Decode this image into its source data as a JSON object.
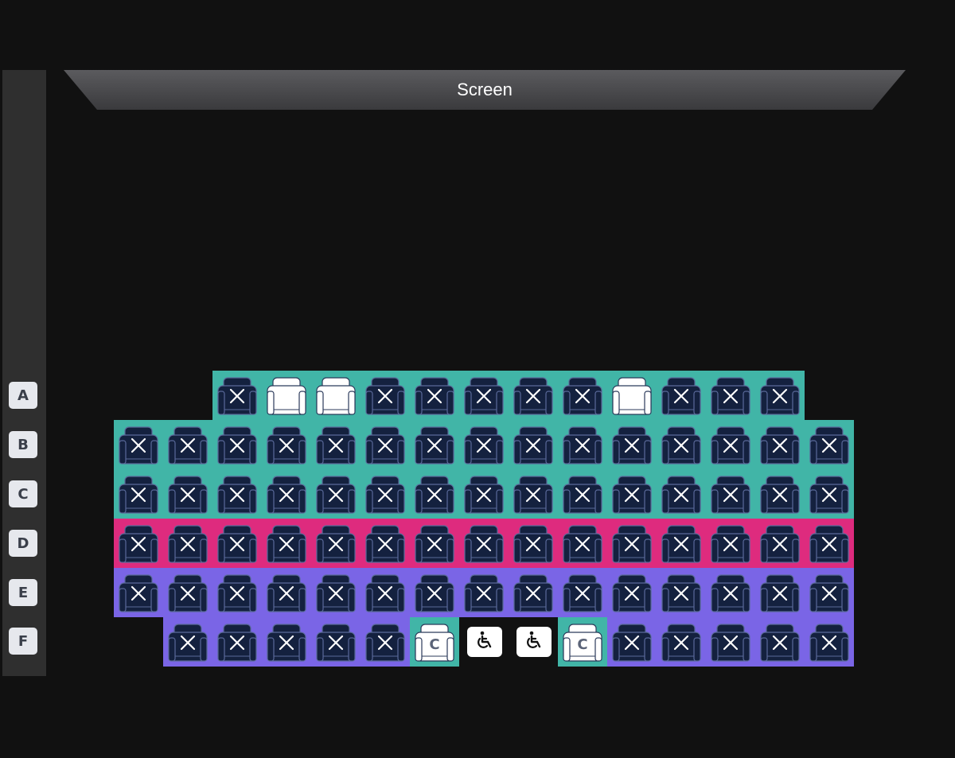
{
  "screen": {
    "label": "Screen"
  },
  "colors": {
    "background": "#111111",
    "sidebar": "#2f2f2f",
    "zone_teal": "#41b5a7",
    "zone_pink": "#de2b7e",
    "zone_purple": "#7a65e6",
    "seat_taken": "#14213f",
    "seat_available": "#ffffff",
    "row_label_bg": "#e6e8ed"
  },
  "rows": [
    {
      "label": "A",
      "zone": "teal",
      "seats": [
        {
          "col": 4,
          "status": "taken"
        },
        {
          "col": 5,
          "status": "available"
        },
        {
          "col": 6,
          "status": "available"
        },
        {
          "col": 7,
          "status": "taken"
        },
        {
          "col": 8,
          "status": "taken"
        },
        {
          "col": 9,
          "status": "taken"
        },
        {
          "col": 10,
          "status": "taken"
        },
        {
          "col": 11,
          "status": "taken"
        },
        {
          "col": 12,
          "status": "available"
        },
        {
          "col": 13,
          "status": "taken"
        },
        {
          "col": 14,
          "status": "taken"
        },
        {
          "col": 15,
          "status": "taken"
        }
      ]
    },
    {
      "label": "B",
      "zone": "teal",
      "seats": [
        {
          "col": 2,
          "status": "taken"
        },
        {
          "col": 3,
          "status": "taken"
        },
        {
          "col": 4,
          "status": "taken"
        },
        {
          "col": 5,
          "status": "taken"
        },
        {
          "col": 6,
          "status": "taken"
        },
        {
          "col": 7,
          "status": "taken"
        },
        {
          "col": 8,
          "status": "taken"
        },
        {
          "col": 9,
          "status": "taken"
        },
        {
          "col": 10,
          "status": "taken"
        },
        {
          "col": 11,
          "status": "taken"
        },
        {
          "col": 12,
          "status": "taken"
        },
        {
          "col": 13,
          "status": "taken"
        },
        {
          "col": 14,
          "status": "taken"
        },
        {
          "col": 15,
          "status": "taken"
        },
        {
          "col": 16,
          "status": "taken"
        }
      ]
    },
    {
      "label": "C",
      "zone": "teal",
      "seats": [
        {
          "col": 2,
          "status": "taken"
        },
        {
          "col": 3,
          "status": "taken"
        },
        {
          "col": 4,
          "status": "taken"
        },
        {
          "col": 5,
          "status": "taken"
        },
        {
          "col": 6,
          "status": "taken"
        },
        {
          "col": 7,
          "status": "taken"
        },
        {
          "col": 8,
          "status": "taken"
        },
        {
          "col": 9,
          "status": "taken"
        },
        {
          "col": 10,
          "status": "taken"
        },
        {
          "col": 11,
          "status": "taken"
        },
        {
          "col": 12,
          "status": "taken"
        },
        {
          "col": 13,
          "status": "taken"
        },
        {
          "col": 14,
          "status": "taken"
        },
        {
          "col": 15,
          "status": "taken"
        },
        {
          "col": 16,
          "status": "taken"
        }
      ]
    },
    {
      "label": "D",
      "zone": "pink",
      "seats": [
        {
          "col": 2,
          "status": "taken"
        },
        {
          "col": 3,
          "status": "taken"
        },
        {
          "col": 4,
          "status": "taken"
        },
        {
          "col": 5,
          "status": "taken"
        },
        {
          "col": 6,
          "status": "taken"
        },
        {
          "col": 7,
          "status": "taken"
        },
        {
          "col": 8,
          "status": "taken"
        },
        {
          "col": 9,
          "status": "taken"
        },
        {
          "col": 10,
          "status": "taken"
        },
        {
          "col": 11,
          "status": "taken"
        },
        {
          "col": 12,
          "status": "taken"
        },
        {
          "col": 13,
          "status": "taken"
        },
        {
          "col": 14,
          "status": "taken"
        },
        {
          "col": 15,
          "status": "taken"
        },
        {
          "col": 16,
          "status": "taken"
        }
      ]
    },
    {
      "label": "E",
      "zone": "purple",
      "seats": [
        {
          "col": 2,
          "status": "taken"
        },
        {
          "col": 3,
          "status": "taken"
        },
        {
          "col": 4,
          "status": "taken"
        },
        {
          "col": 5,
          "status": "taken"
        },
        {
          "col": 6,
          "status": "taken"
        },
        {
          "col": 7,
          "status": "taken"
        },
        {
          "col": 8,
          "status": "taken"
        },
        {
          "col": 9,
          "status": "taken"
        },
        {
          "col": 10,
          "status": "taken"
        },
        {
          "col": 11,
          "status": "taken"
        },
        {
          "col": 12,
          "status": "taken"
        },
        {
          "col": 13,
          "status": "taken"
        },
        {
          "col": 14,
          "status": "taken"
        },
        {
          "col": 15,
          "status": "taken"
        },
        {
          "col": 16,
          "status": "taken"
        }
      ]
    },
    {
      "label": "F",
      "zone": "purple",
      "seats": [
        {
          "col": 3,
          "status": "taken"
        },
        {
          "col": 4,
          "status": "taken"
        },
        {
          "col": 5,
          "status": "taken"
        },
        {
          "col": 6,
          "status": "taken"
        },
        {
          "col": 7,
          "status": "taken"
        },
        {
          "col": 8,
          "status": "companion",
          "zone": "teal",
          "mark": "C"
        },
        {
          "col": 9,
          "status": "wheelchair",
          "zone": "none"
        },
        {
          "col": 10,
          "status": "wheelchair",
          "zone": "none"
        },
        {
          "col": 11,
          "status": "companion",
          "zone": "teal",
          "mark": "C"
        },
        {
          "col": 12,
          "status": "taken"
        },
        {
          "col": 13,
          "status": "taken"
        },
        {
          "col": 14,
          "status": "taken"
        },
        {
          "col": 15,
          "status": "taken"
        },
        {
          "col": 16,
          "status": "taken"
        }
      ]
    }
  ]
}
